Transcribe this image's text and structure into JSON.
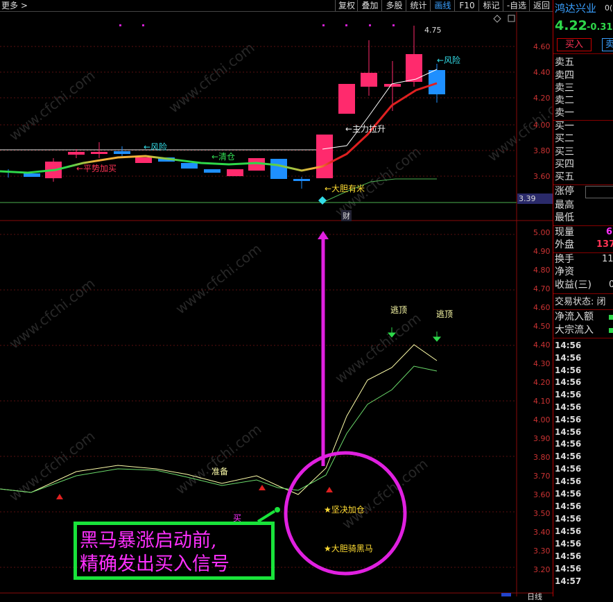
{
  "toolbar": {
    "more_label": "更多 >",
    "buttons": [
      "复权",
      "叠加",
      "多股",
      "统计",
      "画线",
      "F10",
      "标记",
      "-自选",
      "返回"
    ],
    "active_index": 4
  },
  "stock": {
    "name": "鸿达兴业",
    "code_fragment": "0(",
    "price": "4.22",
    "change": "-0.31",
    "buy_button": "买入",
    "sell_button": "卖"
  },
  "order_book": {
    "sells": [
      "卖五",
      "卖四",
      "卖三",
      "卖二",
      "卖一"
    ],
    "buys": [
      "买一",
      "买二",
      "买三",
      "买四",
      "买五"
    ]
  },
  "stats": [
    {
      "label": "涨停",
      "value": ""
    },
    {
      "label": "最高",
      "value": ""
    },
    {
      "label": "最低",
      "value": ""
    },
    {
      "label": "现量",
      "value": "6"
    },
    {
      "label": "外盘",
      "value": "137"
    },
    {
      "label": "换手",
      "value": "11"
    },
    {
      "label": "净资",
      "value": ""
    },
    {
      "label": "收益(三)",
      "value": "0"
    }
  ],
  "trade_status": "交易状态: 闭",
  "flows": [
    {
      "label": "净流入额"
    },
    {
      "label": "大宗流入"
    }
  ],
  "tick_times": [
    "14:56",
    "14:56",
    "14:56",
    "14:56",
    "14:56",
    "14:56",
    "14:56",
    "14:56",
    "14:56",
    "14:56",
    "14:56",
    "14:56",
    "14:56",
    "14:56",
    "14:56",
    "14:56",
    "14:56",
    "14:56",
    "14:56",
    "14:57"
  ],
  "upper_axis": [
    "4.60",
    "4.40",
    "4.20",
    "4.00",
    "3.80",
    "3.60"
  ],
  "upper_price_marker": "3.39",
  "lower_axis": [
    "5.00",
    "4.90",
    "4.80",
    "4.70",
    "4.60",
    "4.50",
    "4.40",
    "4.30",
    "4.20",
    "4.10",
    "4.00",
    "3.90",
    "3.80",
    "3.70",
    "3.60",
    "3.50",
    "3.40",
    "3.30",
    "3.20"
  ],
  "annotations": {
    "high_label": "4.75",
    "risk_top": "←风险",
    "main_force": "←主力拉升",
    "risk_mid": "←风险",
    "clear": "←清仓",
    "trend_add": "←平势加买",
    "bold_buy": "←大胆有米",
    "cai": "财",
    "escape1": "逃顶",
    "escape2": "逃顶",
    "ready": "准备",
    "buy": "买",
    "add_position": "★坚决加仓",
    "ride_horse": "★大胆骑黑马"
  },
  "callout": {
    "line1": "黑马暴涨启动前,",
    "line2": "精确发出买入信号"
  },
  "watermark": "www.cfchi.com",
  "bottom_tab": "日线",
  "colors": {
    "up": "#ff2a6d",
    "down": "#1e8fff",
    "callout_border": "#19e33a",
    "callout_text": "#ff30ff",
    "circle": "#e020e0"
  }
}
